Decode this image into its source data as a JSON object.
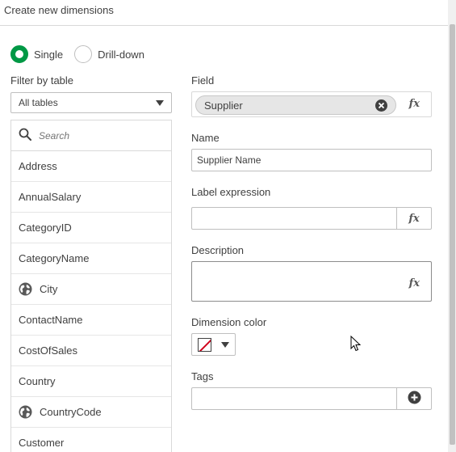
{
  "dialog": {
    "title": "Create new dimensions"
  },
  "dimension_type": {
    "options": [
      {
        "label": "Single",
        "checked": true
      },
      {
        "label": "Drill-down",
        "checked": false
      }
    ]
  },
  "filter": {
    "label": "Filter by table",
    "selected": "All tables"
  },
  "field_list": {
    "search_placeholder": "Search",
    "items": [
      {
        "label": "Address",
        "icon": ""
      },
      {
        "label": "AnnualSalary",
        "icon": ""
      },
      {
        "label": "CategoryID",
        "icon": ""
      },
      {
        "label": "CategoryName",
        "icon": ""
      },
      {
        "label": "City",
        "icon": "globe-icon"
      },
      {
        "label": "ContactName",
        "icon": ""
      },
      {
        "label": "CostOfSales",
        "icon": ""
      },
      {
        "label": "Country",
        "icon": ""
      },
      {
        "label": "CountryCode",
        "icon": "globe-icon"
      },
      {
        "label": "Customer",
        "icon": ""
      }
    ]
  },
  "form": {
    "field_label": "Field",
    "field_value": "Supplier",
    "fx_text": "fx",
    "name_label": "Name",
    "name_value": "Supplier Name",
    "label_expression_label": "Label expression",
    "label_expression_value": "",
    "description_label": "Description",
    "description_value": "",
    "dimension_color_label": "Dimension color",
    "tags_label": "Tags",
    "tags_value": ""
  },
  "colors": {
    "accent": "#009845",
    "text": "#404040",
    "border": "#bfbfbf",
    "no_color_slash": "#d0021b"
  }
}
